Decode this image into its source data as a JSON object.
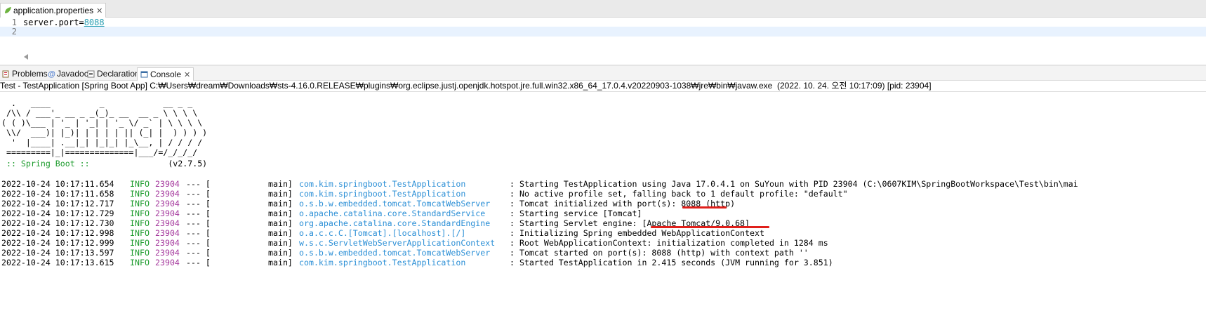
{
  "editor": {
    "tab_title": "application.properties",
    "tab_close": "✕",
    "lines": [
      {
        "num": "1",
        "key": "server.port=",
        "value": "8088"
      },
      {
        "num": "2",
        "key": "",
        "value": ""
      }
    ]
  },
  "views": {
    "tabs": [
      {
        "label": "Problems",
        "icon": "problems-icon"
      },
      {
        "label": "Javadoc",
        "icon": "javadoc-icon"
      },
      {
        "label": "Declaration",
        "icon": "declaration-icon"
      },
      {
        "label": "Console",
        "icon": "console-icon"
      }
    ],
    "close": "✕"
  },
  "console": {
    "launch": "Test - TestApplication [Spring Boot App] C:₩Users₩dream₩Downloads₩sts-4.16.0.RELEASE₩plugins₩org.eclipse.justj.openjdk.hotspot.jre.full.win32.x86_64_17.0.4.v20220903-1038₩jre₩bin₩javaw.exe  (2022. 10. 24. 오전 10:17:09) [pid: 23904]",
    "banner": [
      "  .   ____          _            __ _ _",
      " /\\\\ / ___'_ __ _ _(_)_ __  __ _ \\ \\ \\ \\",
      "( ( )\\___ | '_ | '_| | '_ \\/ _` | \\ \\ \\ \\",
      " \\\\/  ___)| |_)| | | | | || (_| |  ) ) ) )",
      "  '  |____| .__|_| |_|_| |_\\__, | / / / /",
      " =========|_|==============|___/=/_/_/_/"
    ],
    "spring_label": " :: Spring Boot :: ",
    "spring_version": "               (v2.7.5)",
    "rows": [
      {
        "ts": "2022-10-24 10:17:11.654",
        "level": "INFO",
        "pid": "23904",
        "dash": "--- [",
        "thread": "main]",
        "logger": "com.kim.springboot.TestApplication",
        "msg": ": Starting TestApplication using Java 17.0.4.1 on SuYoun with PID 23904 (C:\\0607KIM\\SpringBootWorkspace\\Test\\bin\\mai"
      },
      {
        "ts": "2022-10-24 10:17:11.658",
        "level": "INFO",
        "pid": "23904",
        "dash": "--- [",
        "thread": "main]",
        "logger": "com.kim.springboot.TestApplication",
        "msg": ": No active profile set, falling back to 1 default profile: \"default\""
      },
      {
        "ts": "2022-10-24 10:17:12.717",
        "level": "INFO",
        "pid": "23904",
        "dash": "--- [",
        "thread": "main]",
        "logger": "o.s.b.w.embedded.tomcat.TomcatWebServer",
        "msg": ": Tomcat initialized with port(s): 8088 (http)"
      },
      {
        "ts": "2022-10-24 10:17:12.729",
        "level": "INFO",
        "pid": "23904",
        "dash": "--- [",
        "thread": "main]",
        "logger": "o.apache.catalina.core.StandardService",
        "msg": ": Starting service [Tomcat]"
      },
      {
        "ts": "2022-10-24 10:17:12.730",
        "level": "INFO",
        "pid": "23904",
        "dash": "--- [",
        "thread": "main]",
        "logger": "org.apache.catalina.core.StandardEngine",
        "msg": ": Starting Servlet engine: [Apache Tomcat/9.0.68]"
      },
      {
        "ts": "2022-10-24 10:17:12.998",
        "level": "INFO",
        "pid": "23904",
        "dash": "--- [",
        "thread": "main]",
        "logger": "o.a.c.c.C.[Tomcat].[localhost].[/]",
        "msg": ": Initializing Spring embedded WebApplicationContext"
      },
      {
        "ts": "2022-10-24 10:17:12.999",
        "level": "INFO",
        "pid": "23904",
        "dash": "--- [",
        "thread": "main]",
        "logger": "w.s.c.ServletWebServerApplicationContext",
        "msg": ": Root WebApplicationContext: initialization completed in 1284 ms"
      },
      {
        "ts": "2022-10-24 10:17:13.597",
        "level": "INFO",
        "pid": "23904",
        "dash": "--- [",
        "thread": "main]",
        "logger": "o.s.b.w.embedded.tomcat.TomcatWebServer",
        "msg": ": Tomcat started on port(s): 8088 (http) with context path ''"
      },
      {
        "ts": "2022-10-24 10:17:13.615",
        "level": "INFO",
        "pid": "23904",
        "dash": "--- [",
        "thread": "main]",
        "logger": "com.kim.springboot.TestApplication",
        "msg": ": Started TestApplication in 2.415 seconds (JVM running for 3.851)"
      }
    ]
  },
  "colors": {
    "annotation_red": "#e0201b",
    "logger_blue": "#2b8fd6",
    "level_green": "#1c9b2c",
    "pid_purple": "#a4379c"
  }
}
